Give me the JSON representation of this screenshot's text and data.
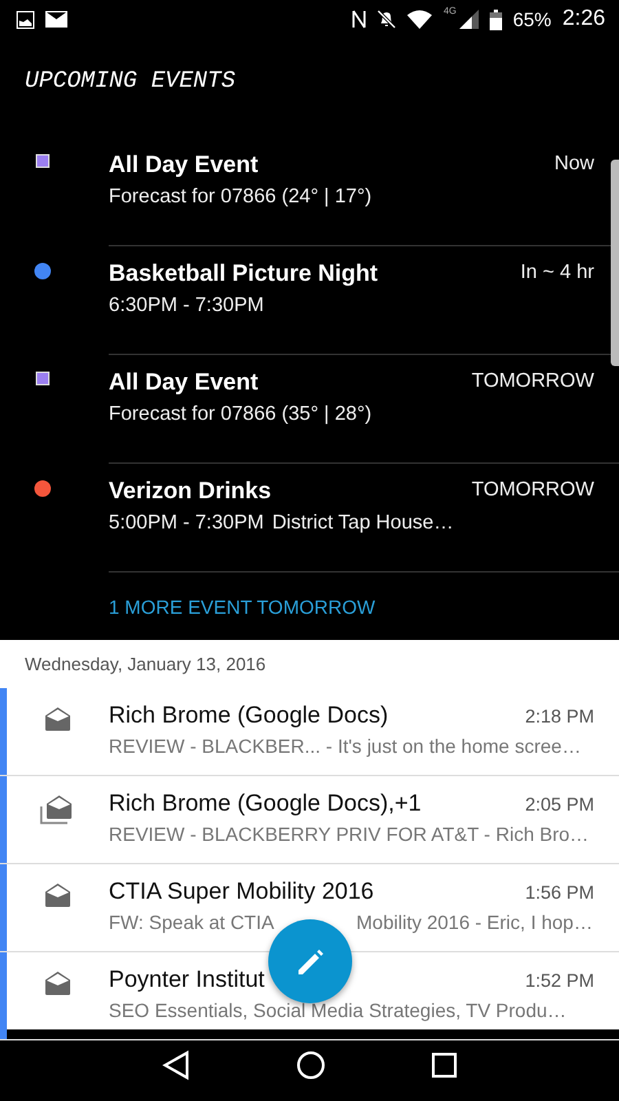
{
  "status_bar": {
    "network_type": "4G",
    "battery": "65%",
    "time": "2:26"
  },
  "events": {
    "title": "UPCOMING EVENTS",
    "items": [
      {
        "kind": "all_day",
        "color": "#9b7ff0",
        "title": "All Day Event",
        "subtitle": "Forecast for 07866 (24° | 17°)",
        "when": "Now"
      },
      {
        "kind": "event",
        "color": "#4285f4",
        "title": "Basketball Picture Night",
        "subtitle": "6:30PM - 7:30PM",
        "when": "In ~ 4 hr"
      },
      {
        "kind": "all_day",
        "color": "#9b7ff0",
        "title": "All Day Event",
        "subtitle": "Forecast for 07866 (35° | 28°)",
        "when": "TOMORROW"
      },
      {
        "kind": "event",
        "color": "#f4563c",
        "title": "Verizon Drinks",
        "subtitle": "5:00PM - 7:30PM",
        "location": "District Tap House…",
        "when": "TOMORROW"
      }
    ],
    "more_link": "1 MORE EVENT TOMORROW"
  },
  "mail": {
    "date_header": "Wednesday, January 13, 2016",
    "items": [
      {
        "kind": "single",
        "unread": true,
        "sender": "Rich Brome (Google Docs)",
        "time": "2:18 PM",
        "preview": "REVIEW - BLACKBER... - It's just on the home scree…"
      },
      {
        "kind": "thread",
        "unread": true,
        "sender": "Rich Brome (Google Docs),+1",
        "time": "2:05 PM",
        "preview": "REVIEW - BLACKBERRY PRIV FOR AT&T - Rich Bro…"
      },
      {
        "kind": "single",
        "unread": true,
        "sender": "CTIA Super Mobility 2016",
        "time": "1:56 PM",
        "preview": "FW: Speak at CTIA",
        "preview_after_button": "Mobility 2016 - Eric, I hop…"
      },
      {
        "kind": "single",
        "unread": true,
        "sender": "Poynter Institut",
        "time": "1:52 PM",
        "preview": "SEO Essentials, Social Media Strategies, TV Produ…"
      }
    ]
  }
}
